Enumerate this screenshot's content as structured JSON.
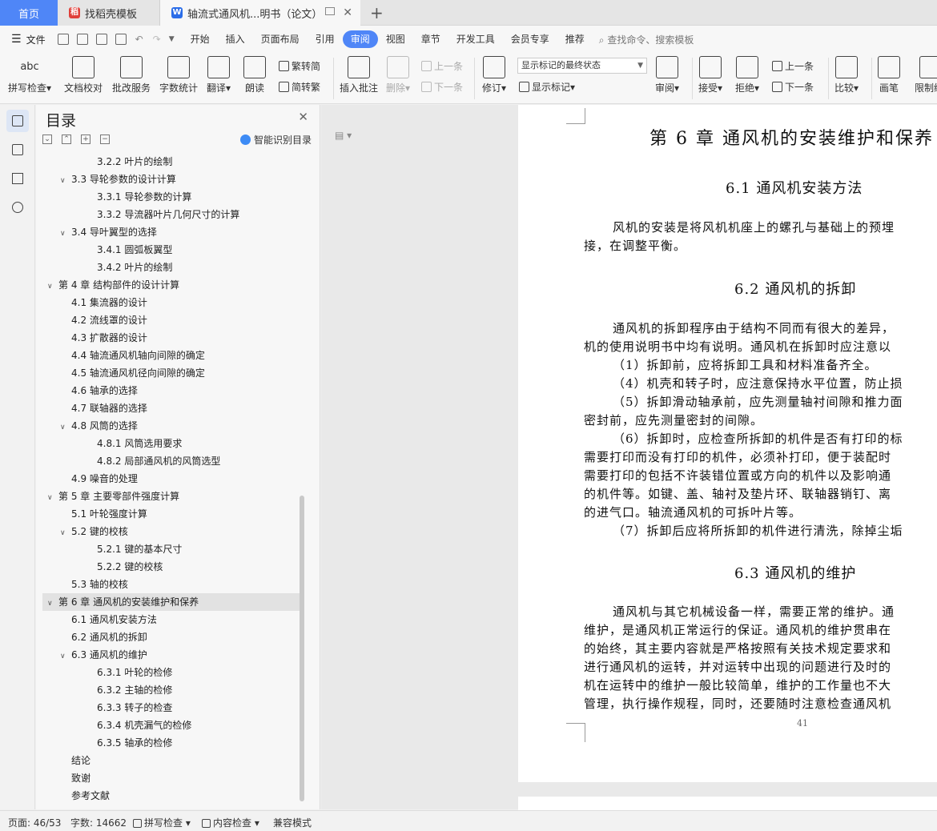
{
  "tabs": {
    "home": "首页",
    "template": "找稻壳模板",
    "doc": "轴流式通风机...明书（论文）",
    "add": "+"
  },
  "menu": {
    "file": "文件",
    "items": [
      "开始",
      "插入",
      "页面布局",
      "引用",
      "审阅",
      "视图",
      "章节",
      "开发工具",
      "会员专享",
      "推荐"
    ],
    "active": "审阅",
    "search": "查找命令、搜索模板"
  },
  "ribbon": {
    "spellcheck": "拼写检查",
    "doccheck": "文档校对",
    "revise_service": "批改服务",
    "wordcount": "字数统计",
    "translate": "翻译",
    "read": "朗读",
    "to_trad": "繁转简",
    "to_simp": "简转繁",
    "insert_comment": "插入批注",
    "delete": "删除",
    "prev": "上一条",
    "next": "下一条",
    "track": "修订",
    "markup_state": "显示标记的最终状态",
    "show_markup": "显示标记",
    "review": "审阅",
    "accept": "接受",
    "reject": "拒绝",
    "prev2": "上一条",
    "next2": "下一条",
    "compare": "比较",
    "pen": "画笔",
    "restrict": "限制编"
  },
  "toc": {
    "title": "目录",
    "smart": "智能识别目录",
    "items": [
      {
        "level": 3,
        "text": "3.2.2 叶片的绘制",
        "arrow": ""
      },
      {
        "level": 2,
        "text": "3.3 导轮参数的设计计算",
        "arrow": "v"
      },
      {
        "level": 3,
        "text": "3.3.1 导轮参数的计算",
        "arrow": ""
      },
      {
        "level": 3,
        "text": "3.3.2 导流器叶片几何尺寸的计算",
        "arrow": ""
      },
      {
        "level": 2,
        "text": "3.4 导叶翼型的选择",
        "arrow": "v"
      },
      {
        "level": 3,
        "text": "3.4.1  圆弧板翼型",
        "arrow": ""
      },
      {
        "level": 3,
        "text": "3.4.2 叶片的绘制",
        "arrow": ""
      },
      {
        "level": 1,
        "text": "第 4 章  结构部件的设计计算",
        "arrow": "v"
      },
      {
        "level": 2,
        "text": "4.1 集流器的设计",
        "arrow": ""
      },
      {
        "level": 2,
        "text": "4.2 流线罩的设计",
        "arrow": ""
      },
      {
        "level": 2,
        "text": "4.3 扩散器的设计",
        "arrow": ""
      },
      {
        "level": 2,
        "text": "4.4 轴流通风机轴向间隙的确定",
        "arrow": ""
      },
      {
        "level": 2,
        "text": "4.5 轴流通风机径向间隙的确定",
        "arrow": ""
      },
      {
        "level": 2,
        "text": "4.6 轴承的选择",
        "arrow": ""
      },
      {
        "level": 2,
        "text": "4.7 联轴器的选择",
        "arrow": ""
      },
      {
        "level": 2,
        "text": "4.8 风筒的选择",
        "arrow": "v"
      },
      {
        "level": 3,
        "text": "4.8.1 风筒选用要求",
        "arrow": ""
      },
      {
        "level": 3,
        "text": "4.8.2 局部通风机的风筒选型",
        "arrow": ""
      },
      {
        "level": 2,
        "text": "4.9 噪音的处理",
        "arrow": ""
      },
      {
        "level": 1,
        "text": "第 5 章  主要零部件强度计算",
        "arrow": "v"
      },
      {
        "level": 2,
        "text": "5.1 叶轮强度计算",
        "arrow": ""
      },
      {
        "level": 2,
        "text": "5.2 键的校核",
        "arrow": "v"
      },
      {
        "level": 3,
        "text": "5.2.1  键的基本尺寸",
        "arrow": ""
      },
      {
        "level": 3,
        "text": "5.2.2  键的校核",
        "arrow": ""
      },
      {
        "level": 2,
        "text": "5.3 轴的校核",
        "arrow": ""
      },
      {
        "level": 1,
        "text": "第 6 章  通风机的安装维护和保养",
        "arrow": "v",
        "selected": true
      },
      {
        "level": 2,
        "text": "6.1 通风机安装方法",
        "arrow": ""
      },
      {
        "level": 2,
        "text": "6.2 通风机的拆卸",
        "arrow": ""
      },
      {
        "level": 2,
        "text": "6.3 通风机的维护",
        "arrow": "v"
      },
      {
        "level": 3,
        "text": "6.3.1 叶轮的检修",
        "arrow": ""
      },
      {
        "level": 3,
        "text": "6.3.2 主轴的检修",
        "arrow": ""
      },
      {
        "level": 3,
        "text": "6.3.3 转子的检查",
        "arrow": ""
      },
      {
        "level": 3,
        "text": "6.3.4 机壳漏气的检修",
        "arrow": ""
      },
      {
        "level": 3,
        "text": "6.3.5 轴承的检修",
        "arrow": ""
      },
      {
        "level": 1,
        "text": "结论",
        "arrow": "",
        "plain": true
      },
      {
        "level": 1,
        "text": "致谢",
        "arrow": "",
        "plain": true
      },
      {
        "level": 1,
        "text": "参考文献",
        "arrow": "",
        "plain": true
      }
    ]
  },
  "doc": {
    "chapter_title": "第 6 章  通风机的安装维护和保养",
    "s61": "6.1 通风机安装方法",
    "s61_p": [
      "风机的安装是将风机机座上的螺孔与基础上的预埋",
      "接，在调整平衡。"
    ],
    "s62": "6.2 通风机的拆卸",
    "s62_p": [
      "通风机的拆卸程序由于结构不同而有很大的差异，",
      "机的使用说明书中均有说明。通风机在拆卸时应注意以",
      "（1）拆卸前，应将拆卸工具和材料准备齐全。",
      "（4）机壳和转子时，应注意保持水平位置，防止损",
      "（5）拆卸滑动轴承前，应先测量轴衬间隙和推力面",
      "密封前，应先测量密封的间隙。",
      "（6）拆卸时，应检查所拆卸的机件是否有打印的标",
      "需要打印而没有打印的机件，必须补打印，便于装配时",
      "需要打印的包括不许装错位置或方向的机件以及影响通",
      "的机件等。如键、盖、轴衬及垫片环、联轴器销钉、离",
      "的进气口。轴流通风机的可拆叶片等。",
      "（7）拆卸后应将所拆卸的机件进行清洗，除掉尘垢"
    ],
    "s63": "6.3 通风机的维护",
    "s63_p": [
      "通风机与其它机械设备一样，需要正常的维护。通",
      "维护，是通风机正常运行的保证。通风机的维护贯串在",
      "的始终，其主要内容就是严格按照有关技术规定要求和",
      "进行通风机的运转，并对运转中出现的问题进行及时的",
      "机在运转中的维护一般比较简单，维护的工作量也不大",
      "管理，执行操作规程，同时，还要随时注意检查通风机"
    ],
    "page_number": "41"
  },
  "status": {
    "page": "页面: 46/53",
    "words": "字数: 14662",
    "spell": "拼写检查",
    "content": "内容检查",
    "compat": "兼容模式"
  },
  "colors": {
    "accent": "#4f86f7",
    "toc_selected": "#e2e2e2"
  }
}
